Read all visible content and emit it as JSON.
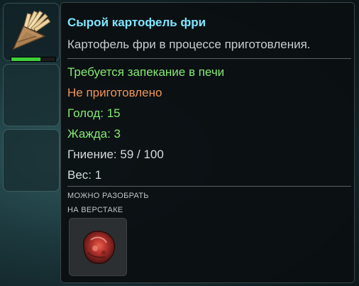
{
  "inventory": {
    "selected_item": {
      "icon": "raw-fries-icon",
      "durability_fraction": 0.66
    },
    "empty_slots": 2
  },
  "tooltip": {
    "title": "Сырой картофель фри",
    "description": "Картофель фри в процессе приготовления.",
    "requirement": "Требуется запекание в печи",
    "status": "Не приготовлено",
    "hunger_label": "Голод:",
    "hunger_value": "15",
    "thirst_label": "Жажда:",
    "thirst_value": "3",
    "spoil_label": "Гниение:",
    "spoil_value": "59 / 100",
    "weight_label": "Вес:",
    "weight_value": "1",
    "salvage_line1": "МОЖНО РАЗОБРАТЬ",
    "salvage_line2": "НА ВЕРСТАКЕ",
    "salvage_icon": "organic-scrap-icon"
  },
  "colors": {
    "title": "#7fe6ff",
    "requirement": "#86e872",
    "status": "#f0945a",
    "hunger": "#86e872",
    "thirst": "#86e872",
    "spoil": "#d6dadc",
    "weight": "#d6dadc",
    "durability": "#3fce3a"
  }
}
